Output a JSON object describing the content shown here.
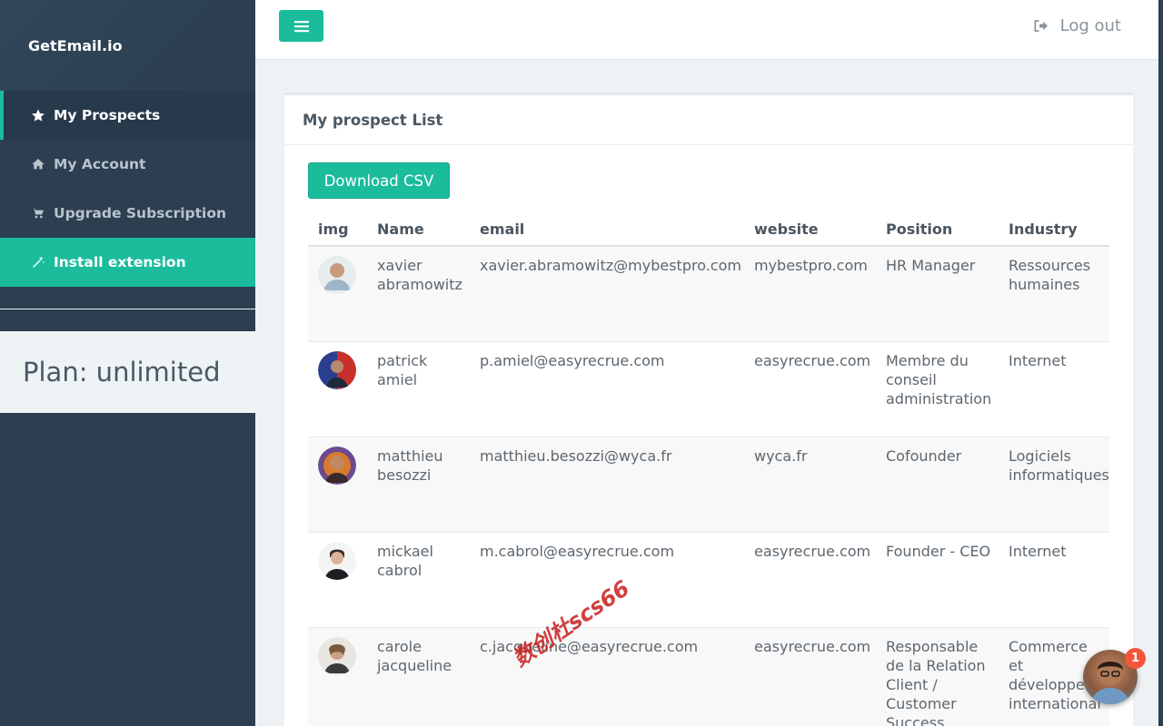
{
  "app": {
    "brand": "GetEmail.io"
  },
  "sidebar": {
    "items": [
      {
        "label": "My Prospects",
        "icon": "star-icon"
      },
      {
        "label": "My Account",
        "icon": "home-icon"
      },
      {
        "label": "Upgrade Subscription",
        "icon": "cart-icon"
      },
      {
        "label": "Install extension",
        "icon": "magic-wand-icon"
      }
    ],
    "plan": "Plan: unlimited"
  },
  "topbar": {
    "logout_label": "Log out",
    "logout_icon": "sign-out-icon",
    "menu_icon": "hamburger-icon"
  },
  "panel": {
    "title": "My prospect List",
    "download_label": "Download CSV"
  },
  "table": {
    "headers": [
      "img",
      "Name",
      "email",
      "website",
      "Position",
      "Industry"
    ],
    "rows": [
      {
        "name": "xavier abramowitz",
        "email": "xavier.abramowitz@mybestpro.com",
        "website": "mybestpro.com",
        "position": "HR Manager",
        "industry": "Ressources humaines"
      },
      {
        "name": "patrick amiel",
        "email": "p.amiel@easyrecrue.com",
        "website": "easyrecrue.com",
        "position": "Membre du conseil administration",
        "industry": "Internet"
      },
      {
        "name": "matthieu besozzi",
        "email": "matthieu.besozzi@wyca.fr",
        "website": "wyca.fr",
        "position": "Cofounder",
        "industry": "Logiciels informatiques"
      },
      {
        "name": "mickael cabrol",
        "email": "m.cabrol@easyrecrue.com",
        "website": "easyrecrue.com",
        "position": "Founder - CEO",
        "industry": "Internet"
      },
      {
        "name": "carole jacqueline",
        "email": "c.jacqueline@easyrecrue.com",
        "website": "easyrecrue.com",
        "position": "Responsable de la Relation Client / Customer Success",
        "industry": "Commerce et développement international"
      }
    ]
  },
  "chat": {
    "badge": "1"
  },
  "watermark": "数创杜scs66",
  "colors": {
    "accent": "#1abc9c",
    "sidebar": "#2c3e50",
    "badge": "#f3553b"
  }
}
